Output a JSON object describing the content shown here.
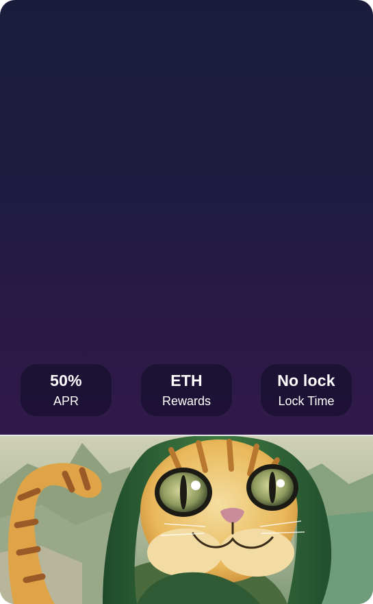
{
  "stats": [
    {
      "value": "50%",
      "label": "APR"
    },
    {
      "value": "ETH",
      "label": "Rewards"
    },
    {
      "value": "No lock",
      "label": "Lock Time"
    }
  ],
  "artwork": {
    "subject": "cat-character-illustration-icon"
  },
  "colors": {
    "panel_top": "#1b1c3b",
    "panel_bottom": "#311a4b",
    "pill_bg": "#120f28",
    "text": "#ffffff"
  }
}
